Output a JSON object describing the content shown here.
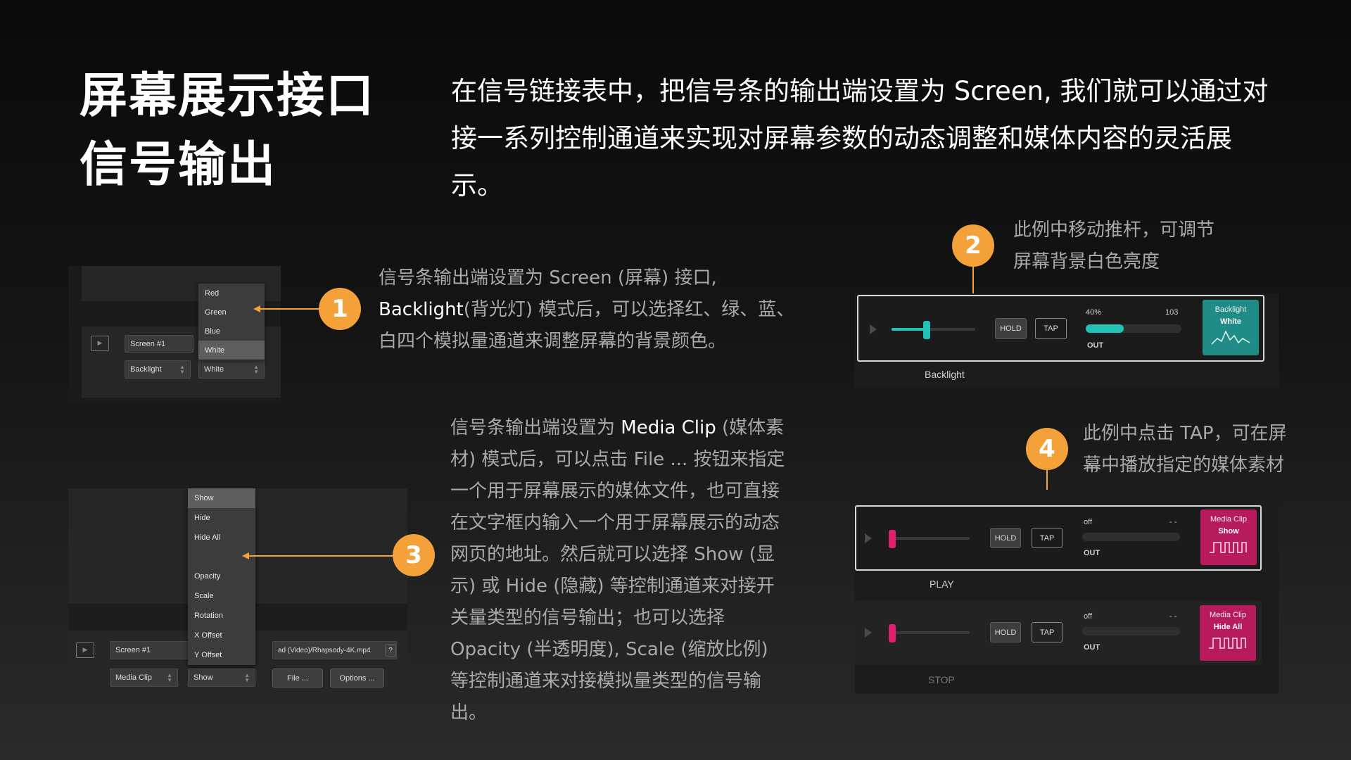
{
  "title": {
    "line1": "屏幕展示接口",
    "line2": "信号输出"
  },
  "intro": "在信号链接表中，把信号条的输出端设置为 Screen, 我们就可以通过对接一系列控制通道来实现对屏幕参数的动态调整和媒体内容的灵活展示。",
  "desc1": {
    "p1": "信号条输出端设置为 Screen (屏幕) 接口, ",
    "bold": "Backlight",
    "p2": "(背光灯) 模式后，可以选择红、绿、蓝、白四个模拟量通道来调整屏幕的背景颜色。"
  },
  "desc2": "此例中移动推杆，可调节屏幕背景白色亮度",
  "desc3": {
    "p1": "信号条输出端设置为 ",
    "bold": "Media Clip",
    "p2": " (媒体素材) 模式后，可以点击 File ... 按钮来指定一个用于屏幕展示的媒体文件，也可直接在文字框内输入一个用于屏幕展示的动态网页的地址。然后就可以选择 Show (显示) 或 Hide (隐藏) 等控制通道来对接开关量类型的信号输出；也可以选择 Opacity (半透明度), Scale (缩放比例) 等控制通道来对接模拟量类型的信号输出。"
  },
  "desc4": "此例中点击 TAP，可在屏幕中播放指定的媒体素材",
  "badges": {
    "b1": "1",
    "b2": "2",
    "b3": "3",
    "b4": "4"
  },
  "panel1": {
    "menu": [
      "Red",
      "Green",
      "Blue",
      "White"
    ],
    "selected_index": 3,
    "screen_field": "Screen #1",
    "mode_field": "Backlight",
    "channel_field": "White"
  },
  "panel3": {
    "menu": [
      "Show",
      "Hide",
      "Hide All",
      "",
      "Opacity",
      "Scale",
      "Rotation",
      "X Offset",
      "Y Offset"
    ],
    "selected_index": 0,
    "screen_field": "Screen #1",
    "mode_field": "Media Clip",
    "channel_field": "Show",
    "file_path": "ad (Video)/Rhapsody-4K.mp4",
    "help_label": "?",
    "file_button": "File ...",
    "options_button": "Options ..."
  },
  "panel2": {
    "hold": "HOLD",
    "tap": "TAP",
    "pct": "40%",
    "value": "103",
    "out": "OUT",
    "level": 0.4,
    "tile_title": "Backlight",
    "tile_sub": "White",
    "strip_label": "Backlight",
    "colors": {
      "tile": "#1f8c86",
      "bar": "#22c3b6"
    }
  },
  "panel4": {
    "strips": [
      {
        "hold": "HOLD",
        "tap": "TAP",
        "state": "off",
        "value": "- -",
        "out": "OUT",
        "tile_title": "Media Clip",
        "tile_sub": "Show",
        "label": "PLAY"
      },
      {
        "hold": "HOLD",
        "tap": "TAP",
        "state": "off",
        "value": "- -",
        "out": "OUT",
        "tile_title": "Media Clip",
        "tile_sub": "Hide All",
        "label": "STOP"
      }
    ],
    "colors": {
      "tile": "#b81a5e",
      "knob": "#e0206e"
    }
  },
  "colors": {
    "accent": "#f4a13a",
    "background": "#111111"
  }
}
